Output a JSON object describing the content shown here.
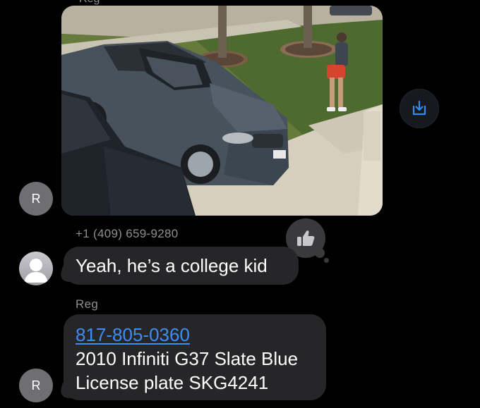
{
  "thread": {
    "top_sender_name": "Reg",
    "photo_message": {
      "avatar_initial": "R"
    },
    "save_button_icon": "share-save-icon",
    "message_1": {
      "sender": "+1 (409) 659-9280",
      "text": "Yeah, he’s a college kid",
      "tapback_icon": "thumbs-up-icon"
    },
    "message_2": {
      "sender": "Reg",
      "phone_link": "817-805-0360",
      "line_1": "2010 Infiniti G37 Slate Blue",
      "line_2": "License plate SKG4241",
      "avatar_initial": "R"
    }
  },
  "colors": {
    "background": "#000000",
    "bubble": "#262628",
    "link": "#3d8ef0",
    "accent_save": "#2f8cf5",
    "sender_gray": "#8e8e93"
  }
}
